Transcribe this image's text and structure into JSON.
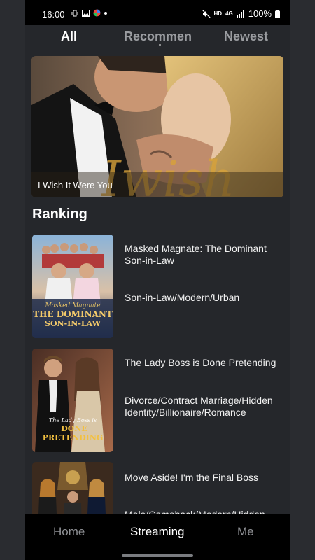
{
  "status_bar": {
    "time": "16:00",
    "hd": "HD",
    "network": "4G",
    "battery": "100%"
  },
  "tabs": [
    {
      "label": "All",
      "active": true
    },
    {
      "label": "Recommen",
      "active": false
    },
    {
      "label": "Newest",
      "active": false
    }
  ],
  "hero": {
    "title": "I Wish It Were You",
    "overlay_text": "Iwish"
  },
  "ranking": {
    "heading": "Ranking",
    "items": [
      {
        "title": "Masked Magnate: The Dominant Son-in-Law",
        "tags": "Son-in-Law/Modern/Urban",
        "cover_text": [
          "Masked Magnate",
          "THE DOMINANT",
          "SON-IN-LAW"
        ]
      },
      {
        "title": "The Lady Boss is Done Pretending",
        "tags": "Divorce/Contract Marriage/Hidden Identity/Billionaire/Romance",
        "cover_text": [
          "The Lady Boss is",
          "DONE",
          "PRETENDING"
        ]
      },
      {
        "title": "Move Aside! I'm the Final Boss",
        "tags": "Male/Comeback/Modern/Hidden",
        "cover_text": []
      }
    ]
  },
  "bottom_nav": [
    {
      "label": "Home",
      "active": false
    },
    {
      "label": "Streaming",
      "active": true
    },
    {
      "label": "Me",
      "active": false
    }
  ],
  "colors": {
    "background": "#25272b",
    "bar": "#000000",
    "active_text": "#ffffff",
    "inactive_text": "#8f9195"
  }
}
